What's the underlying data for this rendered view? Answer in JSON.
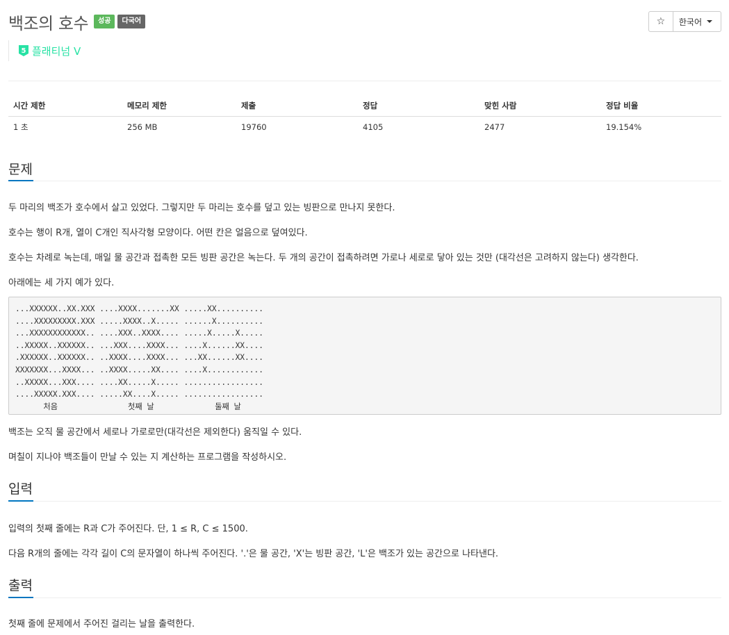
{
  "problem": {
    "title": "백조의 호수",
    "badges": {
      "success": "성공",
      "multilang": "다국어"
    },
    "tier": {
      "number": "5",
      "label": "플래티넘 V",
      "color": "#27e2a4"
    }
  },
  "toolbar": {
    "star_icon": "star-icon",
    "star_glyph": "☆",
    "language": "한국어"
  },
  "info_table": {
    "headers": [
      "시간 제한",
      "메모리 제한",
      "제출",
      "정답",
      "맞힌 사람",
      "정답 비율"
    ],
    "values": [
      "1 초",
      "256 MB",
      "19760",
      "4105",
      "2477",
      "19.154%"
    ]
  },
  "sections": {
    "problem": {
      "title": "문제",
      "p1": "두 마리의 백조가 호수에서 살고 있었다. 그렇지만 두 마리는 호수를 덮고 있는 빙판으로 만나지 못한다.",
      "p2": "호수는 행이 R개, 열이 C개인 직사각형 모양이다. 어떤 칸은 얼음으로 덮여있다.",
      "p3": "호수는 차례로 녹는데, 매일 물 공간과 접촉한 모든 빙판 공간은 녹는다. 두 개의 공간이 접촉하려면 가로나 세로로 닿아 있는 것만 (대각선은 고려하지 않는다) 생각한다.",
      "p4": "아래에는 세 가지 예가 있다.",
      "example": "...XXXXXX..XX.XXX ....XXXX.......XX .....XX..........\n....XXXXXXXXX.XXX .....XXXX..X..... ......X..........\n...XXXXXXXXXXXX.. ....XXX..XXXX.... .....X.....X.....\n..XXXXX..XXXXXX.. ...XXX....XXXX... ....X......XX....\n.XXXXXX..XXXXXX.. ..XXXX....XXXX... ...XX......XX....\nXXXXXXX...XXXX... ..XXXX.....XX.... ....X............\n..XXXXX...XXX.... ....XX.....X..... .................\n....XXXXX.XXX.... .....XX....X..... .................\n      처음               첫째 날             둘째 날",
      "p5": "백조는 오직 물 공간에서 세로나 가로로만(대각선은 제외한다) 움직일 수 있다.",
      "p6": "며칠이 지나야 백조들이 만날 수 있는 지 계산하는 프로그램을 작성하시오."
    },
    "input": {
      "title": "입력",
      "p1": "입력의 첫째 줄에는 R과 C가 주어진다. 단, 1 ≤ R, C ≤ 1500.",
      "p2": "다음 R개의 줄에는 각각 길이 C의 문자열이 하나씩 주어진다. '.'은 물 공간, 'X'는 빙판 공간, 'L'은 백조가 있는 공간으로 나타낸다."
    },
    "output": {
      "title": "출력",
      "p1": "첫째 줄에 문제에서 주어진 걸리는 날을 출력한다."
    }
  }
}
